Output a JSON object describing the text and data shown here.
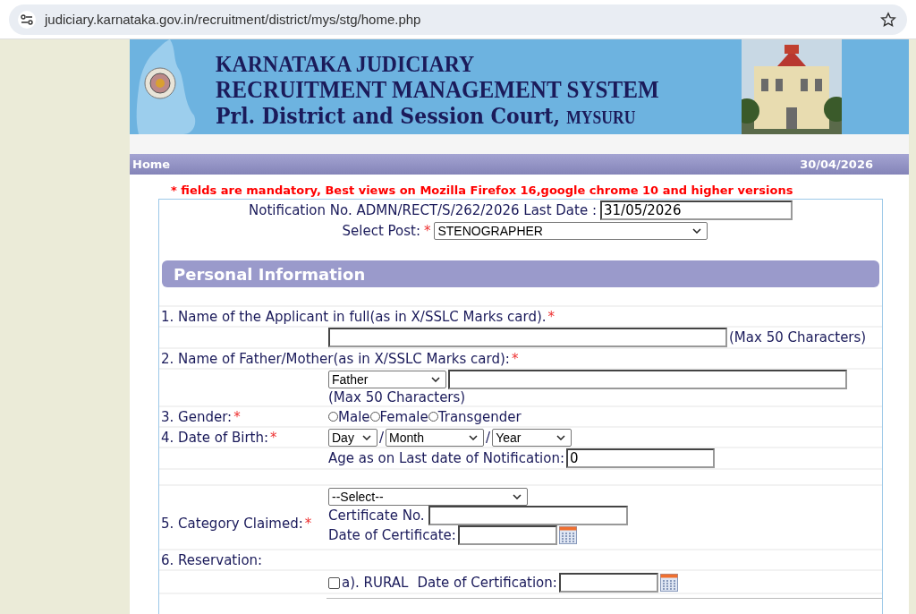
{
  "browser": {
    "url": "judiciary.karnataka.gov.in/recruitment/district/mys/stg/home.php"
  },
  "header": {
    "line1": "KARNATAKA JUDICIARY",
    "line2": "RECRUITMENT MANAGEMENT SYSTEM",
    "line3": "Prl. District and Session Court,",
    "city": "MYSURU"
  },
  "nav": {
    "home": "Home",
    "date": "30/04/2026"
  },
  "notice": "* fields are mandatory, Best views on Mozilla Firefox 16,google chrome 10 and higher versions",
  "notification": {
    "label": "Notification No. ADMN/RECT/S/262/2026 Last Date :",
    "value": "31/05/2026"
  },
  "post": {
    "label": "Select Post:",
    "mark": "*",
    "value": "STENOGRAPHER"
  },
  "section_title": "Personal Information",
  "applicant_name": {
    "label": "1. Name of the Applicant in full(as in X/SSLC Marks card).",
    "mark": "*",
    "hint": "(Max 50 Characters)"
  },
  "parent_name": {
    "label": "2. Name of Father/Mother(as in X/SSLC Marks card):",
    "mark": "*",
    "relation": "Father",
    "hint": "(Max 50 Characters)"
  },
  "gender": {
    "label": "3. Gender:",
    "mark": "*",
    "options": [
      {
        "label": "Male",
        "selected": false
      },
      {
        "label": "Female",
        "selected": false
      },
      {
        "label": "Transgender",
        "selected": false
      }
    ]
  },
  "dob": {
    "label": "4. Date of Birth:",
    "mark": "*",
    "day": "Day",
    "month": "Month",
    "year": "Year",
    "separator_1": "/",
    "separator_2": "/"
  },
  "age": {
    "label": "Age as on Last date of Notification:",
    "value": "0"
  },
  "category": {
    "label": "5. Category Claimed:",
    "mark": "*",
    "value": "--Select--",
    "certificate_no": "Certificate No.",
    "certificate_date": "Date of Certificate:"
  },
  "reservation": {
    "label": "6. Reservation:",
    "items": [
      {
        "label": "a). RURAL",
        "checked": false,
        "date_label": "Date of Certification:"
      }
    ]
  }
}
